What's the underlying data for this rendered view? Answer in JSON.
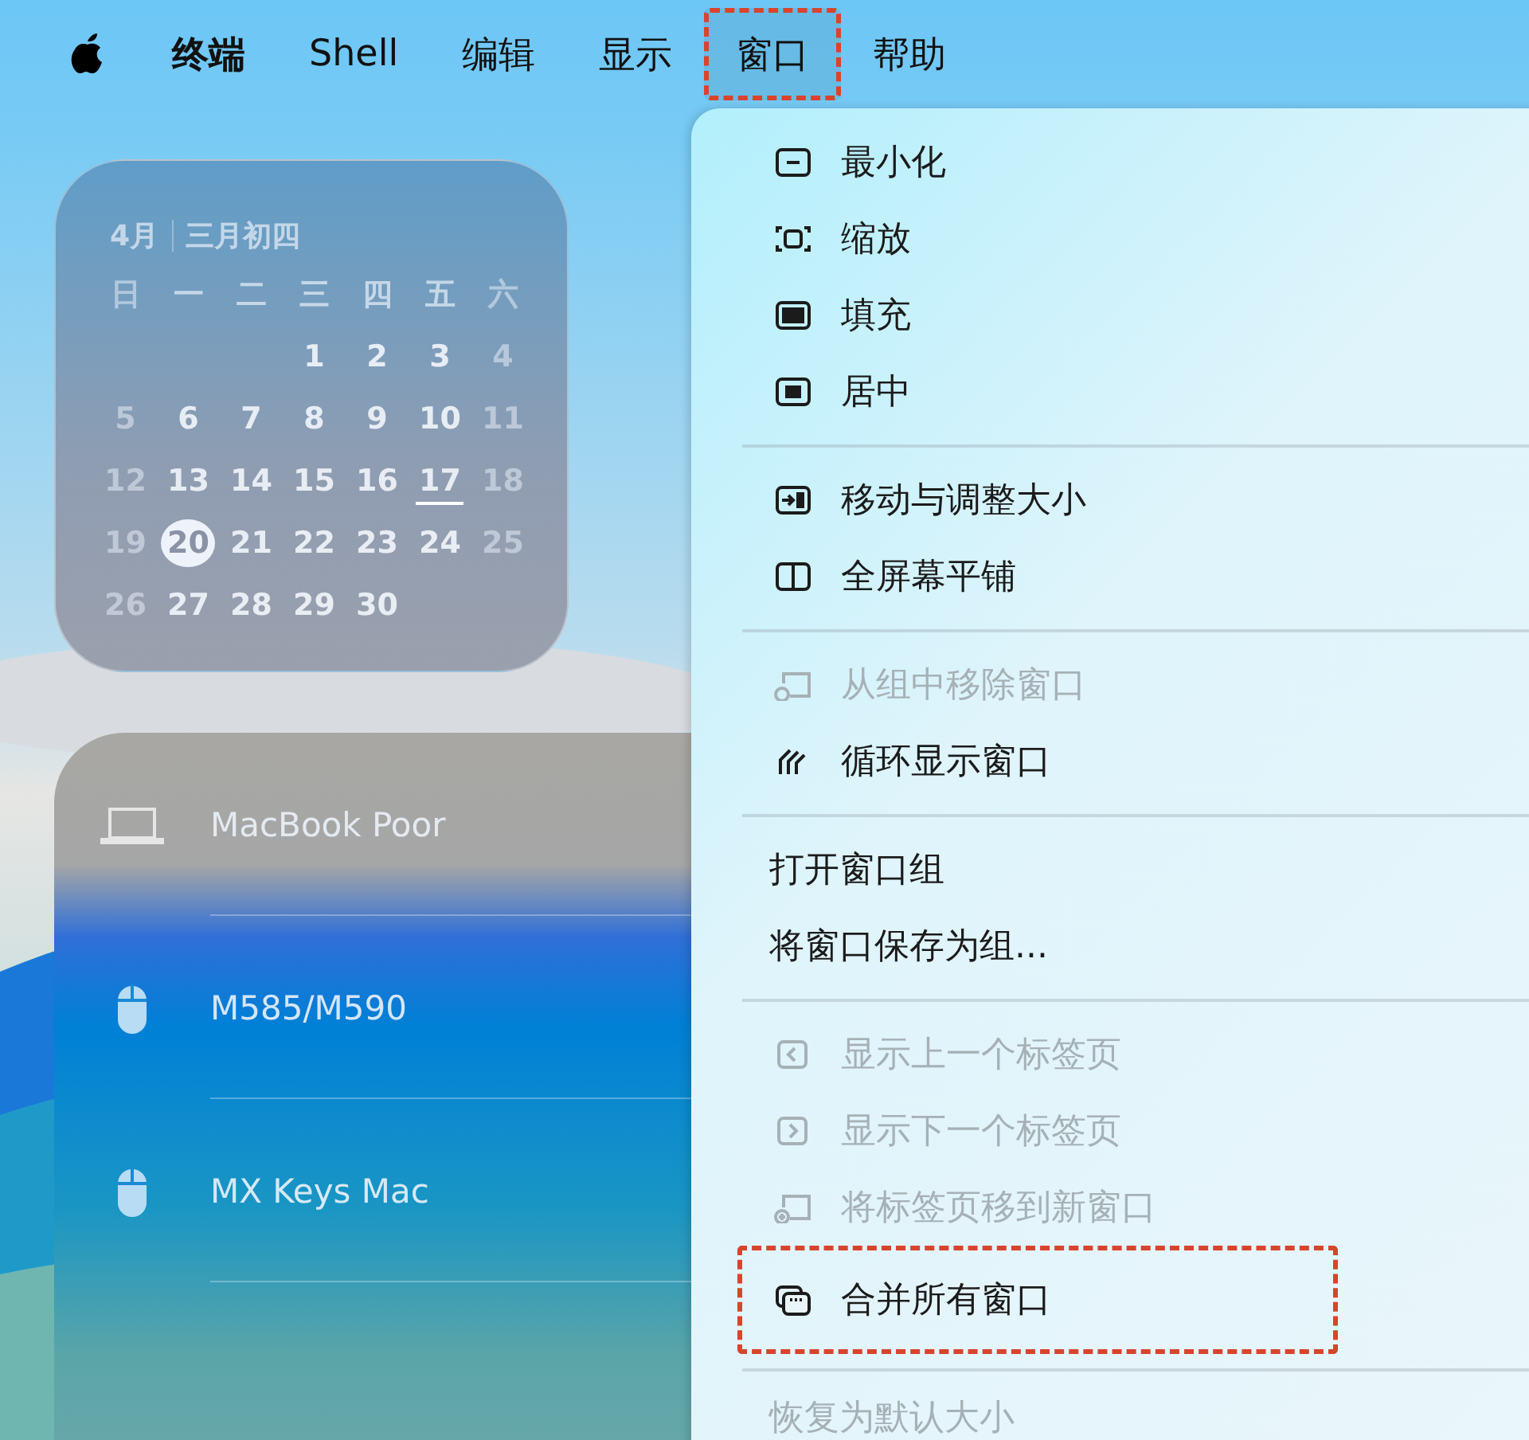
{
  "menu_bar": {
    "items": [
      {
        "kind": "apple",
        "selected": false,
        "highlighted": false
      },
      {
        "kind": "app",
        "label": "终端",
        "selected": false,
        "highlighted": false
      },
      {
        "kind": "menu",
        "label": "Shell",
        "selected": false,
        "highlighted": false
      },
      {
        "kind": "menu",
        "label": "编辑",
        "selected": false,
        "highlighted": false
      },
      {
        "kind": "menu",
        "label": "显示",
        "selected": false,
        "highlighted": false
      },
      {
        "kind": "menu",
        "label": "窗口",
        "selected": true,
        "highlighted": true
      },
      {
        "kind": "menu",
        "label": "帮助",
        "selected": false,
        "highlighted": false
      }
    ]
  },
  "calendar_widget": {
    "month": "4月",
    "lunar_date": "三月初四",
    "weekdays": [
      "日",
      "一",
      "二",
      "三",
      "四",
      "五",
      "六"
    ],
    "weeks": [
      [
        {
          "kind": "empty"
        },
        {
          "kind": "empty"
        },
        {
          "kind": "empty"
        },
        {
          "kind": "day",
          "text": "1"
        },
        {
          "kind": "day",
          "text": "2"
        },
        {
          "kind": "day",
          "text": "3"
        },
        {
          "kind": "day",
          "text": "4"
        }
      ],
      [
        {
          "text": "5"
        },
        {
          "text": "6"
        },
        {
          "text": "7"
        },
        {
          "text": "8"
        },
        {
          "text": "9"
        },
        {
          "text": "10"
        },
        {
          "text": "11"
        }
      ],
      [
        {
          "text": "12"
        },
        {
          "text": "13"
        },
        {
          "text": "14"
        },
        {
          "text": "15"
        },
        {
          "text": "16"
        },
        {
          "text": "17",
          "underlined": true
        },
        {
          "text": "18"
        }
      ],
      [
        {
          "text": "19"
        },
        {
          "text": "20",
          "today": true
        },
        {
          "text": "21"
        },
        {
          "text": "22"
        },
        {
          "text": "23"
        },
        {
          "text": "24"
        },
        {
          "text": "25"
        }
      ],
      [
        {
          "text": "26"
        },
        {
          "text": "27"
        },
        {
          "text": "28"
        },
        {
          "text": "29"
        },
        {
          "text": "30"
        }
      ]
    ]
  },
  "devices_widget": {
    "devices": [
      {
        "kind": "laptop",
        "name": "MacBook Poor"
      },
      {
        "kind": "mouse",
        "name": "M585/M590"
      },
      {
        "kind": "mouse",
        "name": "MX Keys Mac"
      }
    ]
  },
  "window_menu": {
    "sections": [
      [
        {
          "kind": "minimize",
          "label": "最小化",
          "disabled": false,
          "highlighted": false
        },
        {
          "kind": "zoom",
          "label": "缩放",
          "disabled": false,
          "highlighted": false
        },
        {
          "kind": "fill",
          "label": "填充",
          "disabled": false,
          "highlighted": false
        },
        {
          "kind": "center",
          "label": "居中",
          "disabled": false,
          "highlighted": false
        }
      ],
      [
        {
          "kind": "move",
          "label": "移动与调整大小",
          "disabled": false,
          "highlighted": false
        },
        {
          "kind": "tile",
          "label": "全屏幕平铺",
          "disabled": false,
          "highlighted": false
        }
      ],
      [
        {
          "kind": "remove",
          "label": "从组中移除窗口",
          "disabled": true,
          "highlighted": false
        },
        {
          "kind": "cycle",
          "label": "循环显示窗口",
          "disabled": false,
          "highlighted": false
        }
      ],
      [
        {
          "kind": "text",
          "label": "打开窗口组",
          "disabled": false,
          "highlighted": false
        },
        {
          "kind": "text",
          "label": "将窗口保存为组...",
          "disabled": false,
          "highlighted": false
        }
      ],
      [
        {
          "kind": "prev",
          "label": "显示上一个标签页",
          "disabled": true,
          "highlighted": false
        },
        {
          "kind": "next",
          "label": "显示下一个标签页",
          "disabled": true,
          "highlighted": false
        },
        {
          "kind": "newwin",
          "label": "将标签页移到新窗口",
          "disabled": true,
          "highlighted": false
        },
        {
          "kind": "merge",
          "label": "合并所有窗口",
          "disabled": false,
          "highlighted": true
        }
      ],
      [
        {
          "kind": "text",
          "label": "恢复为默认大小",
          "disabled": true,
          "highlighted": false
        }
      ]
    ]
  }
}
